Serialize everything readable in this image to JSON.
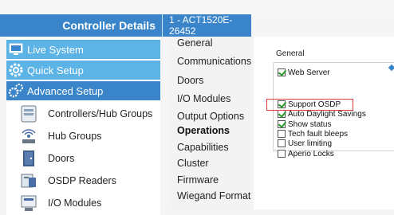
{
  "header": {
    "title": "Controller Details",
    "controller_name": "1 - ACT1520E-26452"
  },
  "nav": {
    "top_items": [
      {
        "label": "Live System",
        "icon": "monitor-icon",
        "color": "#5cb4e6"
      },
      {
        "label": "Quick Setup",
        "icon": "gear-icon",
        "color": "#5cb4e6"
      },
      {
        "label": "Advanced Setup",
        "icon": "gears-icon",
        "color": "#3a85c9"
      }
    ],
    "sub_items": [
      {
        "label": "Controllers/Hub Groups",
        "icon": "controller-icon"
      },
      {
        "label": "Hub Groups",
        "icon": "wireless-hub-icon"
      },
      {
        "label": "Doors",
        "icon": "door-icon"
      },
      {
        "label": "OSDP Readers",
        "icon": "reader-icon"
      },
      {
        "label": "I/O Modules",
        "icon": "io-module-icon"
      }
    ]
  },
  "menu": {
    "items": [
      "General",
      "Communications",
      "Doors",
      "I/O Modules",
      "Output Options",
      "Operations",
      "Capabilities",
      "Cluster",
      "Firmware",
      "Wiegand Format"
    ],
    "active": "Operations"
  },
  "panel": {
    "title": "General",
    "options": [
      {
        "label": "Web Server",
        "checked": true
      },
      {
        "label": "Support OSDP",
        "checked": true
      },
      {
        "label": "Auto Daylight Savings",
        "checked": true
      },
      {
        "label": "Show status",
        "checked": true
      },
      {
        "label": "Tech fault bleeps",
        "checked": false
      },
      {
        "label": "User limiting",
        "checked": false
      },
      {
        "label": "Aperio Locks",
        "checked": false
      }
    ]
  }
}
